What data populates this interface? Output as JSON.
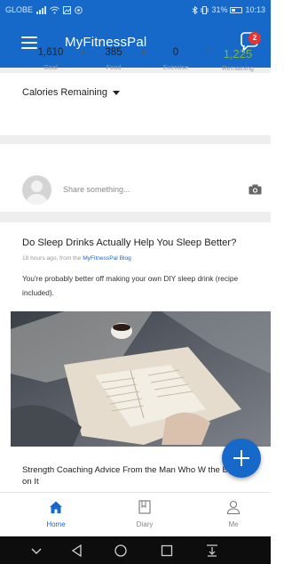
{
  "status_bar": {
    "carrier": "GLOBE",
    "battery": "31%",
    "time": "10:13"
  },
  "app_bar": {
    "title": "MyFitnessPal",
    "messages_badge": "2",
    "accent_color": "#1669c9"
  },
  "calories": {
    "header": "Calories Remaining",
    "goal_value": "1,610",
    "goal_label": "Goal",
    "minus": "−",
    "food_value": "385",
    "food_label": "Food",
    "plus": "+",
    "exercise_value": "0",
    "exercise_label": "Exercise",
    "equals": "=",
    "remaining_value": "1,225",
    "remaining_label": "Remaining",
    "remaining_color": "#7cb342"
  },
  "share": {
    "placeholder": "Share something..."
  },
  "article": {
    "title": "Do Sleep Drinks Actually Help You Sleep Better?",
    "meta_prefix": "18 hours ago, from the",
    "meta_source": "MyFitnessPal Blog",
    "body": "You're probably better off making your own DIY sleep drink (recipe included)."
  },
  "next_article": {
    "title": "Strength Coaching Advice From the Man Who W the Book on It"
  },
  "bottom_nav": {
    "items": [
      {
        "label": "Home",
        "icon": "home-icon",
        "active": true
      },
      {
        "label": "Diary",
        "icon": "diary-icon",
        "active": false
      },
      {
        "label": "Me",
        "icon": "person-icon",
        "active": false
      }
    ]
  },
  "icons": {
    "menu": "hamburger-icon",
    "messages": "chat-bubble-icon",
    "camera": "camera-icon",
    "add": "plus-icon"
  }
}
